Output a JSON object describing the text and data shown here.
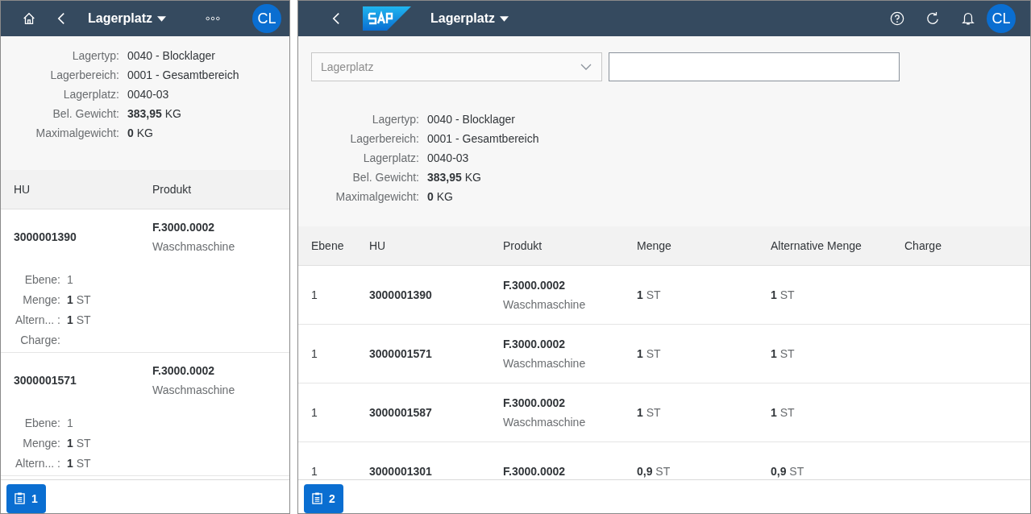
{
  "left": {
    "header": {
      "title": "Lagerplatz",
      "avatar": "CL"
    },
    "info": [
      {
        "label": "Lagertyp:",
        "value": "0040 - Blocklager"
      },
      {
        "label": "Lagerbereich:",
        "value": "0001 - Gesamtbereich"
      },
      {
        "label": "Lagerplatz:",
        "value": "0040-03"
      },
      {
        "label": "Bel. Gewicht:",
        "value": "**383,95** KG"
      },
      {
        "label": "Maximalgewicht:",
        "value": "**0** KG"
      }
    ],
    "columns": [
      "HU",
      "Produkt"
    ],
    "items": [
      {
        "hu": "3000001390",
        "product": "F.3000.0002",
        "product_name": "Waschmaschine",
        "attributes": [
          {
            "label": "Ebene:",
            "value": "1"
          },
          {
            "label": "Menge:",
            "value": "**1** ST"
          },
          {
            "label": "Altern... :",
            "value": "**1** ST"
          },
          {
            "label": "Charge:"
          }
        ]
      },
      {
        "hu": "3000001571",
        "product": "F.3000.0002",
        "product_name": "Waschmaschine",
        "attributes": [
          {
            "label": "Ebene:",
            "value": "1"
          },
          {
            "label": "Menge:",
            "value": "**1** ST"
          },
          {
            "label": "Altern... :",
            "value": "**1** ST"
          }
        ]
      }
    ],
    "footer_button": "1"
  },
  "right": {
    "header": {
      "title": "Lagerplatz",
      "avatar": "CL"
    },
    "filter": {
      "select_placeholder": "Lagerplatz"
    },
    "info": [
      {
        "label": "Lagertyp:",
        "value": "0040 - Blocklager"
      },
      {
        "label": "Lagerbereich:",
        "value": "0001 - Gesamtbereich"
      },
      {
        "label": "Lagerplatz:",
        "value": "0040-03"
      },
      {
        "label": "Bel. Gewicht:",
        "value": "**383,95** KG"
      },
      {
        "label": "Maximalgewicht:",
        "value": "**0** KG"
      }
    ],
    "columns": [
      "Ebene",
      "HU",
      "Produkt",
      "Menge",
      "Alternative Menge",
      "Charge"
    ],
    "rows": [
      {
        "level": "1",
        "hu": "3000001390",
        "product": "F.3000.0002",
        "product_name": "Waschmaschine",
        "qty": "**1** ST",
        "alt_qty": "**1** ST"
      },
      {
        "level": "1",
        "hu": "3000001571",
        "product": "F.3000.0002",
        "product_name": "Waschmaschine",
        "qty": "**1** ST",
        "alt_qty": "**1** ST"
      },
      {
        "level": "1",
        "hu": "3000001587",
        "product": "F.3000.0002",
        "product_name": "Waschmaschine",
        "qty": "**1** ST",
        "alt_qty": "**1** ST"
      },
      {
        "level": "1",
        "hu": "3000001301",
        "product": "F.3000.0002",
        "qty": "**0,9** ST",
        "alt_qty": "**0,9** ST"
      }
    ],
    "footer_button": "2"
  }
}
